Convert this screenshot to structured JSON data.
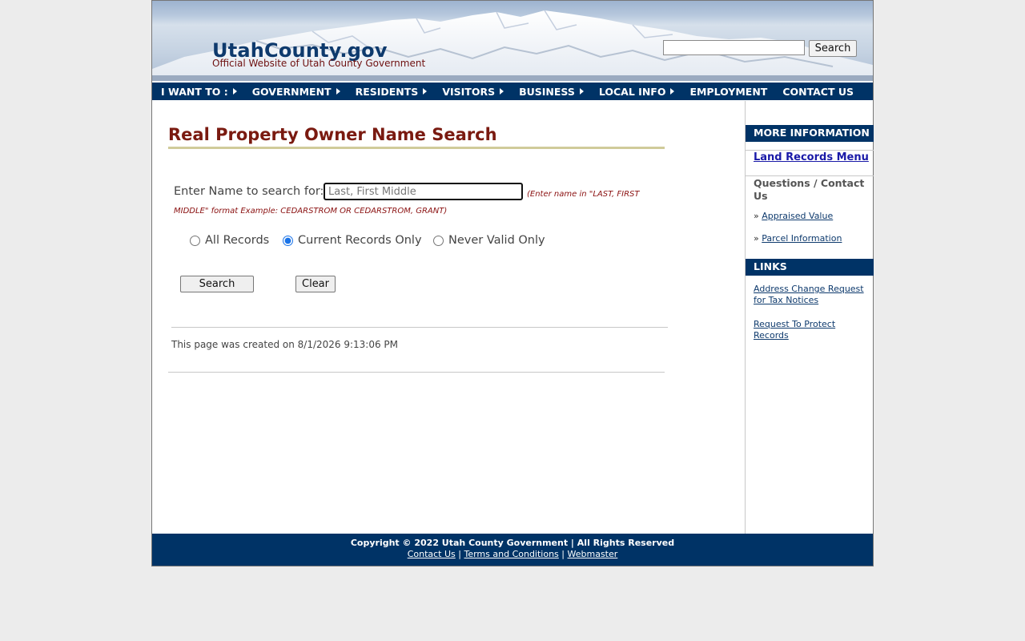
{
  "header": {
    "site_title": "UtahCounty.gov",
    "site_subtitle": "Official Website of Utah County Government",
    "search_button": "Search",
    "search_value": ""
  },
  "nav": {
    "items": [
      {
        "label": "I WANT TO :",
        "has_arrow": true
      },
      {
        "label": "GOVERNMENT",
        "has_arrow": true
      },
      {
        "label": "RESIDENTS",
        "has_arrow": true
      },
      {
        "label": "VISITORS",
        "has_arrow": true
      },
      {
        "label": "BUSINESS",
        "has_arrow": true
      },
      {
        "label": "LOCAL INFO",
        "has_arrow": true
      },
      {
        "label": "EMPLOYMENT",
        "has_arrow": false
      },
      {
        "label": "CONTACT US",
        "has_arrow": false
      }
    ]
  },
  "main": {
    "page_title": "Real Property Owner Name Search",
    "name_label": "Enter Name to search for:",
    "name_placeholder": "Last, First Middle",
    "name_value": "",
    "hint": "(Enter name in \"LAST, FIRST MIDDLE\" format   Example: CEDARSTROM OR CEDARSTROM, GRANT)",
    "radios": [
      {
        "label": "All Records",
        "checked": false
      },
      {
        "label": "Current Records Only",
        "checked": true
      },
      {
        "label": "Never Valid Only",
        "checked": false
      }
    ],
    "search_button": "Search",
    "clear_button": "Clear",
    "created_text": "This page was created on 8/1/2026 9:13:06 PM"
  },
  "sidebar": {
    "more_info_heading": "MORE INFORMATION",
    "land_records_link": "Land Records Menu",
    "questions_title": "Questions / Contact Us",
    "question_links": [
      "Appraised Value",
      "Parcel Information"
    ],
    "bullet": "»",
    "links_heading": "LINKS",
    "links": [
      "Address Change Request for Tax Notices",
      "Request To Protect Records"
    ]
  },
  "footer": {
    "copyright": "Copyright © 2022 Utah County Government | All Rights Reserved",
    "links": [
      "Contact Us",
      "Terms and Conditions",
      "Webmaster"
    ],
    "separator": "|"
  },
  "colors": {
    "nav_bg": "#003366",
    "title_red": "#7a1a10",
    "link_blue": "#0e3a6d"
  }
}
